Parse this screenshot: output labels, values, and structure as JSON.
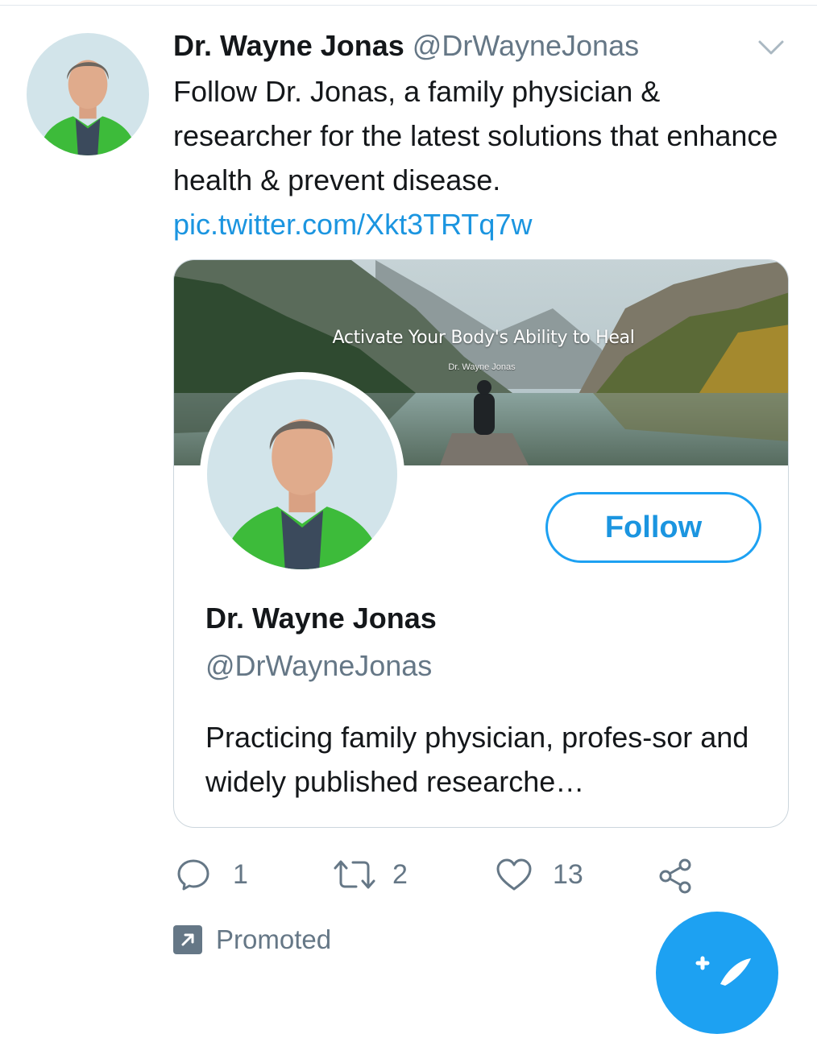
{
  "tweet": {
    "author_name": "Dr. Wayne Jonas",
    "author_handle": "@DrWayneJonas",
    "text": "Follow Dr. Jonas, a family physician & researcher for the latest solutions that enhance health & prevent disease.",
    "link": "pic.twitter.com/Xkt3TRTq7w"
  },
  "card": {
    "banner_title": "Activate Your Body's Ability to Heal",
    "banner_subtitle": "Dr. Wayne Jonas",
    "name": "Dr. Wayne Jonas",
    "handle": "@DrWayneJonas",
    "bio": "Practicing family physician, profes-sor and widely published researche…",
    "follow_label": "Follow"
  },
  "actions": {
    "reply_count": "1",
    "retweet_count": "2",
    "like_count": "13"
  },
  "promoted_label": "Promoted",
  "colors": {
    "accent": "#1da1f2",
    "link": "#1b95e0",
    "secondary_text": "#657786",
    "border": "#ccd6dd"
  },
  "icons": [
    "chevron-down-icon",
    "reply-icon",
    "retweet-icon",
    "like-icon",
    "share-icon",
    "promoted-icon",
    "compose-icon"
  ]
}
